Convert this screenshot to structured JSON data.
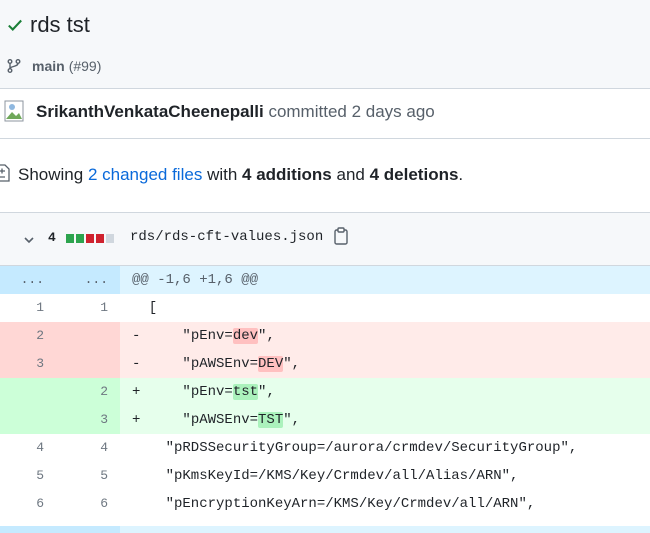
{
  "commit": {
    "title": "rds tst",
    "branch": "main",
    "pr": "(#99)",
    "author": "SrikanthVenkataCheenepalli",
    "action": "committed 2 days ago"
  },
  "summary": {
    "prefix": "Showing",
    "changed": "2 changed files",
    "with": "with",
    "additions": "4 additions",
    "and": "and",
    "deletions": "4 deletions",
    "end": "."
  },
  "file": {
    "count": "4",
    "path": "rds/rds-cft-values.json",
    "bars": [
      "add",
      "add",
      "del",
      "del",
      "neutral"
    ]
  },
  "colors": {
    "add": "#2da44e",
    "del": "#cf222e",
    "neutral": "#d0d7de",
    "link": "#0969da",
    "check": "#1a7f37"
  },
  "diff": {
    "hunk": {
      "old": "...",
      "new": "...",
      "text": "@@ -1,6 +1,6 @@"
    },
    "lines": [
      {
        "type": "ctx",
        "old": "1",
        "new": "1",
        "marker": "",
        "pre": "  [",
        "hl": "",
        "post": ""
      },
      {
        "type": "del",
        "old": "2",
        "new": "",
        "marker": "-",
        "pre": "    \"pEnv=",
        "hl": "dev",
        "post": "\","
      },
      {
        "type": "del",
        "old": "3",
        "new": "",
        "marker": "-",
        "pre": "    \"pAWSEnv=",
        "hl": "DEV",
        "post": "\","
      },
      {
        "type": "add",
        "old": "",
        "new": "2",
        "marker": "+",
        "pre": "    \"pEnv=",
        "hl": "tst",
        "post": "\","
      },
      {
        "type": "add",
        "old": "",
        "new": "3",
        "marker": "+",
        "pre": "    \"pAWSEnv=",
        "hl": "TST",
        "post": "\","
      },
      {
        "type": "ctx",
        "old": "4",
        "new": "4",
        "marker": "",
        "pre": "    \"pRDSSecurityGroup=/aurora/crmdev/SecurityGroup\",",
        "hl": "",
        "post": ""
      },
      {
        "type": "ctx",
        "old": "5",
        "new": "5",
        "marker": "",
        "pre": "    \"pKmsKeyId=/KMS/Key/Crmdev/all/Alias/ARN\",",
        "hl": "",
        "post": ""
      },
      {
        "type": "ctx",
        "old": "6",
        "new": "6",
        "marker": "",
        "pre": "    \"pEncryptionKeyArn=/KMS/Key/Crmdev/all/ARN\",",
        "hl": "",
        "post": ""
      }
    ]
  }
}
